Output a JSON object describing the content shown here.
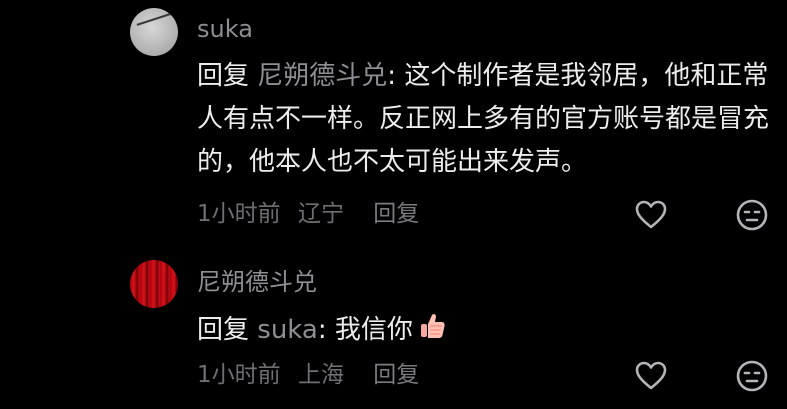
{
  "colors": {
    "background": "#000000",
    "text": "#ededed",
    "muted": "#8e8e93",
    "meta": "#6e6e73"
  },
  "comments": [
    {
      "username": "suka",
      "reply_prefix": "回复",
      "mention": "尼朔德斗兑",
      "separator": ": ",
      "text": "这个制作者是我邻居，他和正常人有点不一样。反正网上多有的官方账号都是冒充的，他本人也不太可能出来发声。",
      "time": "1小时前",
      "location": "辽宁",
      "reply_label": "回复",
      "avatar_icon": "user-avatar-icon",
      "like_icon": "heart-icon",
      "dislike_icon": "unhappy-face-icon"
    },
    {
      "username": "尼朔德斗兑",
      "reply_prefix": "回复",
      "mention": "suka",
      "separator": ": ",
      "text": "我信你",
      "emoji_icon": "thumbs-up-emoji-icon",
      "time": "1小时前",
      "location": "上海",
      "reply_label": "回复",
      "avatar_icon": "red-curtain-avatar-icon",
      "like_icon": "heart-icon",
      "dislike_icon": "unhappy-face-icon"
    }
  ]
}
